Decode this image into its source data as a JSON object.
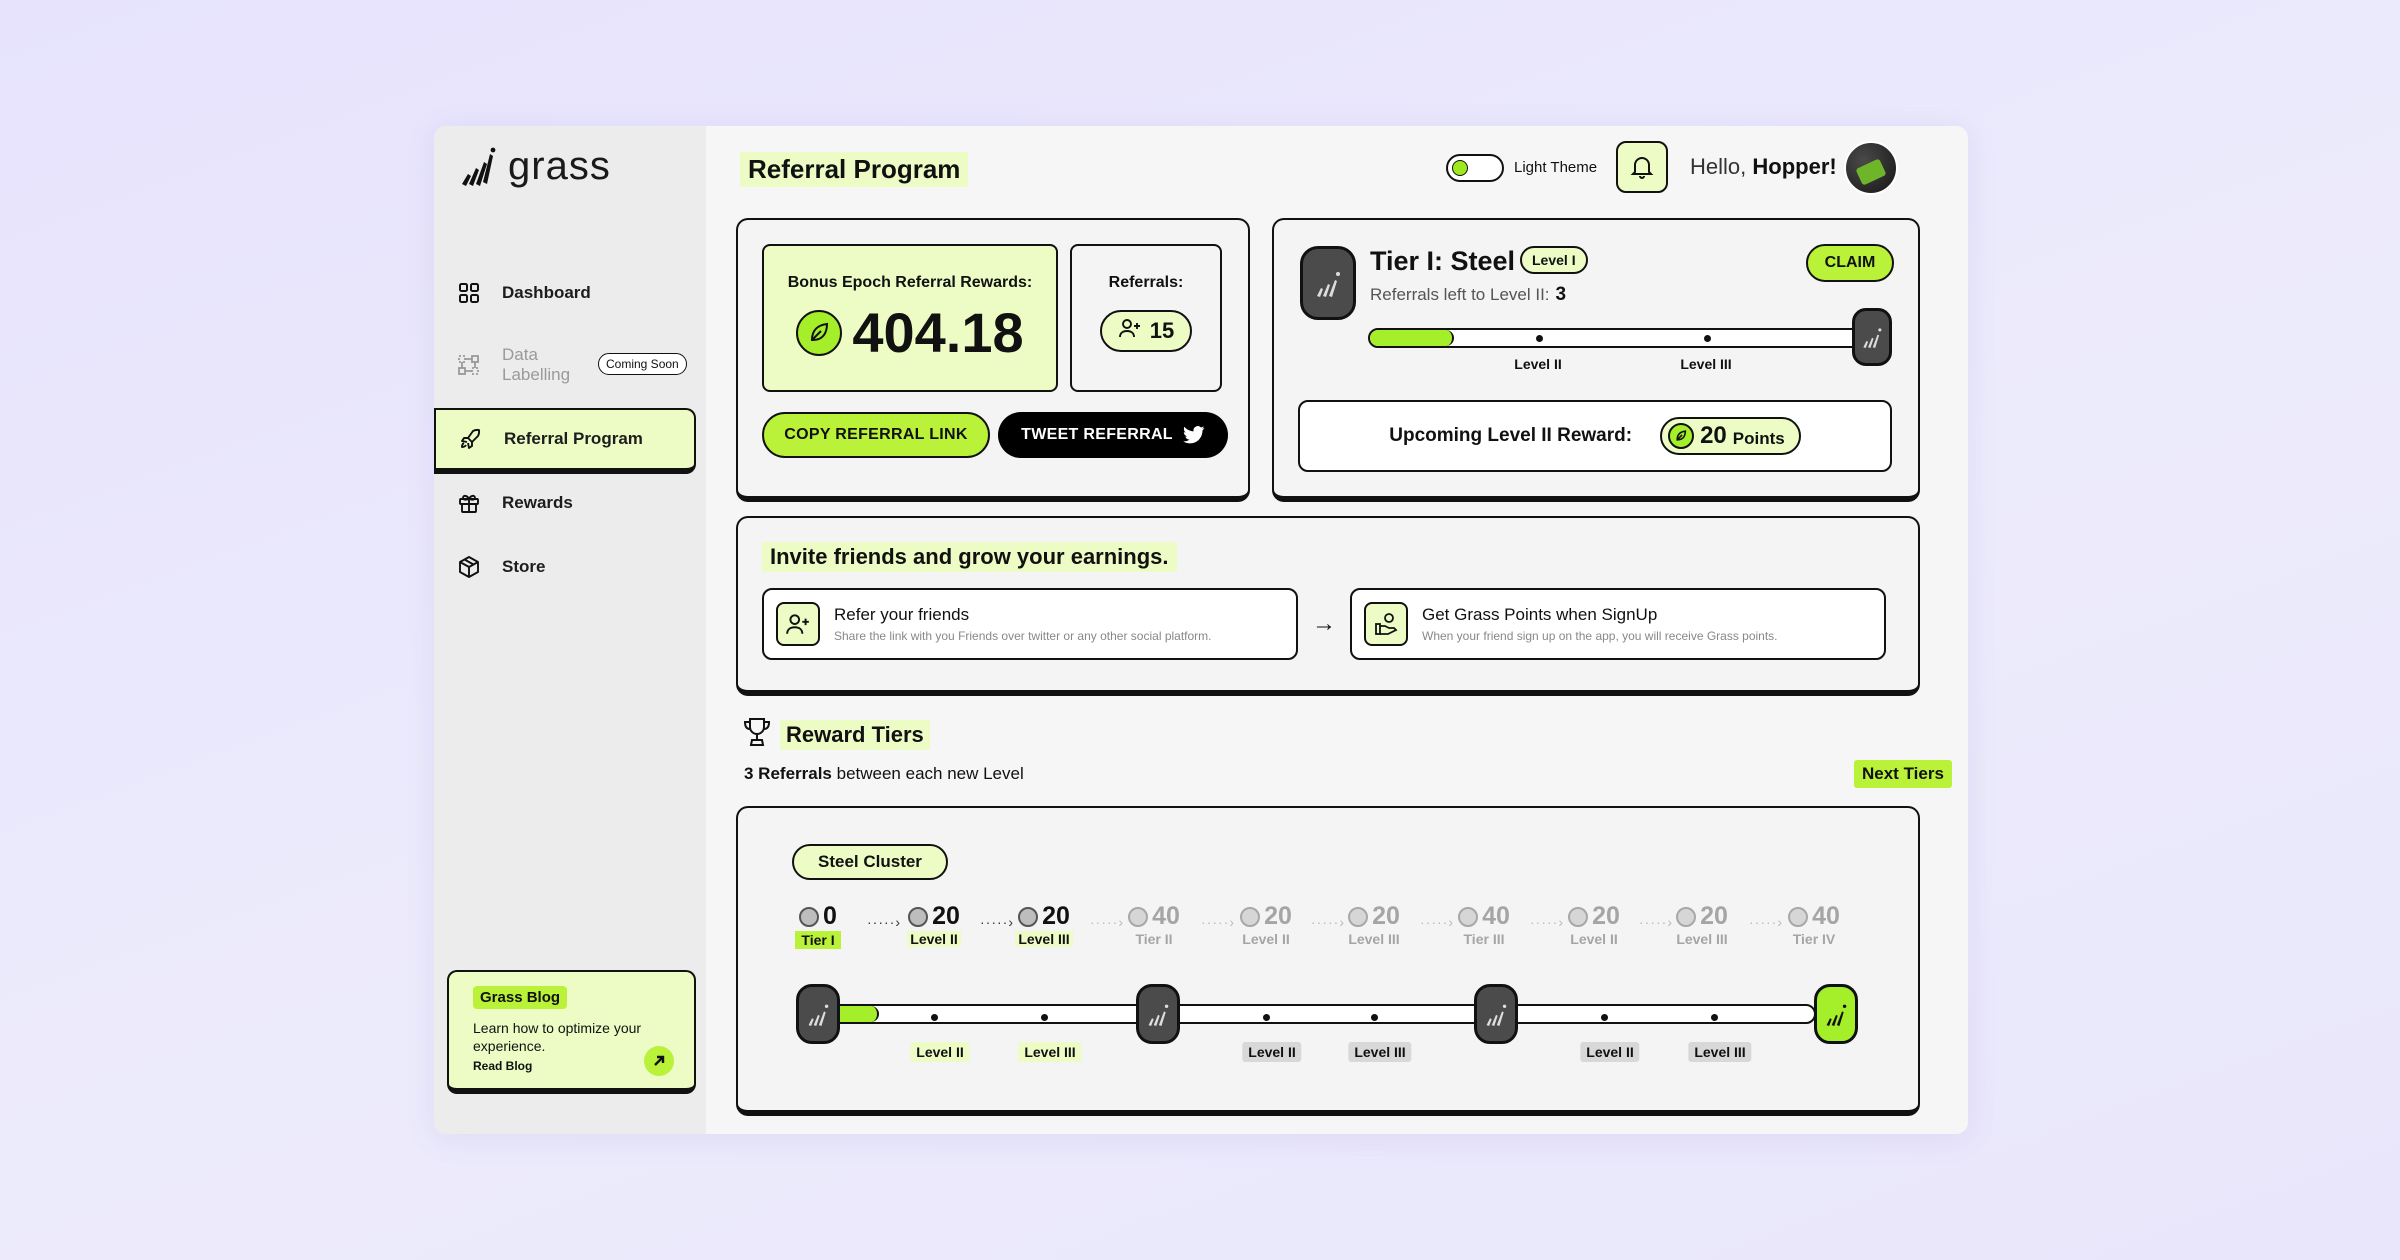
{
  "brand": {
    "name": "grass"
  },
  "sidebar": {
    "items": [
      {
        "label": "Dashboard",
        "icon": "grid-icon"
      },
      {
        "label": "Data Labelling",
        "icon": "data-icon",
        "badge": "Coming Soon"
      },
      {
        "label": "Referral Program",
        "icon": "rocket-icon",
        "active": true
      },
      {
        "label": "Rewards",
        "icon": "gift-icon"
      },
      {
        "label": "Store",
        "icon": "box-icon"
      }
    ],
    "blog": {
      "tag": "Grass Blog",
      "description": "Learn how to optimize your experience.",
      "link": "Read Blog"
    }
  },
  "header": {
    "title": "Referral Program",
    "theme_label": "Light Theme",
    "greeting": "Hello,",
    "username": "Hopper!"
  },
  "bonus": {
    "label": "Bonus Epoch Referral Rewards:",
    "value": "404.18",
    "referrals_label": "Referrals:",
    "referrals_count": "15",
    "copy_button": "COPY REFERRAL LINK",
    "tweet_button": "TWEET REFERRAL"
  },
  "tier": {
    "title": "Tier I: Steel",
    "level": "Level I",
    "left_label": "Referrals left to Level II:",
    "left_value": "3",
    "claim": "CLAIM",
    "progress": 0.17,
    "ticks": [
      "Level II",
      "Level III"
    ],
    "upcoming_label": "Upcoming Level II Reward:",
    "upcoming_value": "20",
    "upcoming_unit": "Points"
  },
  "invite": {
    "title": "Invite friends and grow your earnings.",
    "steps": [
      {
        "title": "Refer your friends",
        "desc": "Share the link with you Friends over twitter or any other social platform."
      },
      {
        "title": "Get Grass Points when SignUp",
        "desc": "When your friend sign up on the app, you will receive Grass points."
      }
    ]
  },
  "reward_tiers": {
    "title": "Reward Tiers",
    "subtitle_bold": "3 Referrals",
    "subtitle_rest": " between each new Level",
    "next_button": "Next Tiers",
    "cluster": "Steel Cluster",
    "columns": [
      {
        "value": "0",
        "label": "Tier I"
      },
      {
        "value": "20",
        "label": "Level II"
      },
      {
        "value": "20",
        "label": "Level III"
      },
      {
        "value": "40",
        "label": "Tier II"
      },
      {
        "value": "20",
        "label": "Level II"
      },
      {
        "value": "20",
        "label": "Level III"
      },
      {
        "value": "40",
        "label": "Tier III"
      },
      {
        "value": "20",
        "label": "Level II"
      },
      {
        "value": "20",
        "label": "Level III"
      },
      {
        "value": "40",
        "label": "Tier IV"
      }
    ],
    "track_labels": [
      "Level II",
      "Level III",
      "Level II",
      "Level III",
      "Level II",
      "Level III"
    ],
    "progress": 0.05
  },
  "colors": {
    "accent": "#b9f239",
    "accent_soft": "#edfcc5",
    "dark": "#111111"
  }
}
